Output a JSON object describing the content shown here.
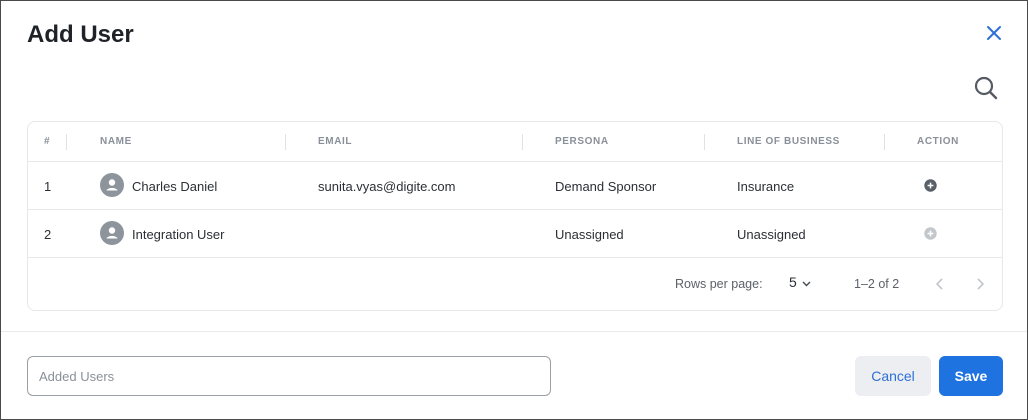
{
  "dialog": {
    "title": "Add User",
    "close_icon": "close-icon",
    "search_icon": "search-icon"
  },
  "colors": {
    "accent": "#1f73e0",
    "close": "#2f6fd6",
    "border": "#e6e8eb"
  },
  "table": {
    "columns": [
      "#",
      "NAME",
      "EMAIL",
      "PERSONA",
      "LINE OF BUSINESS",
      "ACTION"
    ],
    "rows": [
      {
        "index": "1",
        "name": "Charles Daniel",
        "email": "sunita.vyas@digite.com",
        "persona": "Demand Sponsor",
        "line_of_business": "Insurance",
        "action_icon": "add-circle-icon"
      },
      {
        "index": "2",
        "name": "Integration User",
        "email": "",
        "persona": "Unassigned",
        "line_of_business": "Unassigned",
        "action_icon": "add-circle-icon"
      }
    ]
  },
  "pagination": {
    "rows_per_page_label": "Rows per page:",
    "rows_per_page_value": "5",
    "range": "1–2 of 2"
  },
  "footer": {
    "added_users_placeholder": "Added Users",
    "added_users_value": "",
    "cancel_label": "Cancel",
    "save_label": "Save"
  }
}
